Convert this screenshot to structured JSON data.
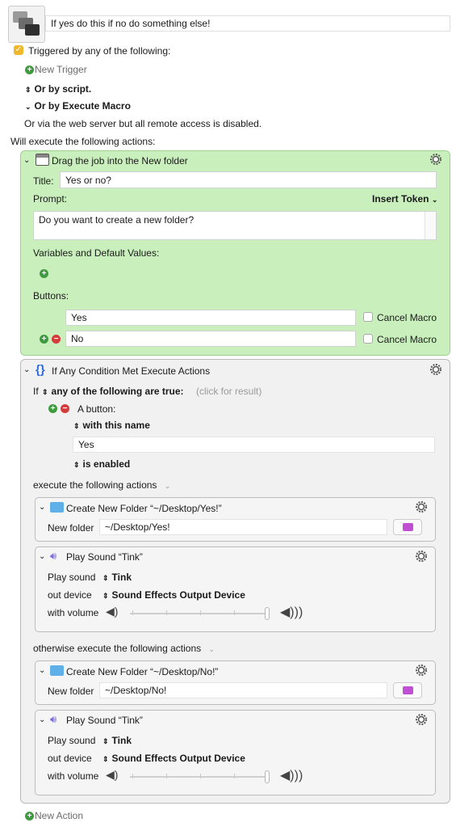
{
  "header": {
    "title_value": "If yes do this if no do something else!"
  },
  "triggers": {
    "checkbox_label": "Triggered by any of the following:",
    "new_trigger": "New Trigger",
    "or_by_script": "Or by script.",
    "or_by_execute_macro": "Or by Execute Macro",
    "web_server_note": "Or via the web server but all remote access is disabled.",
    "will_execute": "Will execute the following actions:"
  },
  "action1": {
    "title": "Drag the job into the New folder",
    "title_label": "Title:",
    "title_value": "Yes or no?",
    "prompt_label": "Prompt:",
    "insert_token": "Insert Token",
    "prompt_value": "Do you want to create a new folder?",
    "variables_label": "Variables and Default Values:",
    "buttons_label": "Buttons:",
    "buttons": [
      {
        "value": "Yes",
        "cancel_label": "Cancel Macro"
      },
      {
        "value": "No",
        "cancel_label": "Cancel Macro"
      }
    ]
  },
  "action2": {
    "title": "If Any Condition Met Execute Actions",
    "if_label": "If",
    "any_label": "any of the following are true:",
    "click_for_result": "(click for result)",
    "condition_label": "A button:",
    "with_this_name": "with this name",
    "name_value": "Yes",
    "is_enabled": "is enabled",
    "execute_label": "execute the following actions",
    "otherwise_label": "otherwise execute the following actions",
    "then_actions": {
      "create_folder": {
        "title": "Create New Folder “~/Desktop/Yes!”",
        "field_label": "New folder",
        "field_value": "~/Desktop/Yes!"
      },
      "play_sound": {
        "title": "Play Sound “Tink”",
        "play_label": "Play sound",
        "sound_value": "Tink",
        "out_label": "out device",
        "out_value": "Sound Effects Output Device",
        "volume_label": "with volume",
        "volume": 1.0
      }
    },
    "else_actions": {
      "create_folder": {
        "title": "Create New Folder “~/Desktop/No!”",
        "field_label": "New folder",
        "field_value": "~/Desktop/No!"
      },
      "play_sound": {
        "title": "Play Sound “Tink”",
        "play_label": "Play sound",
        "sound_value": "Tink",
        "out_label": "out device",
        "out_value": "Sound Effects Output Device",
        "volume_label": "with volume",
        "volume": 1.0
      }
    }
  },
  "footer": {
    "new_action": "New Action"
  }
}
